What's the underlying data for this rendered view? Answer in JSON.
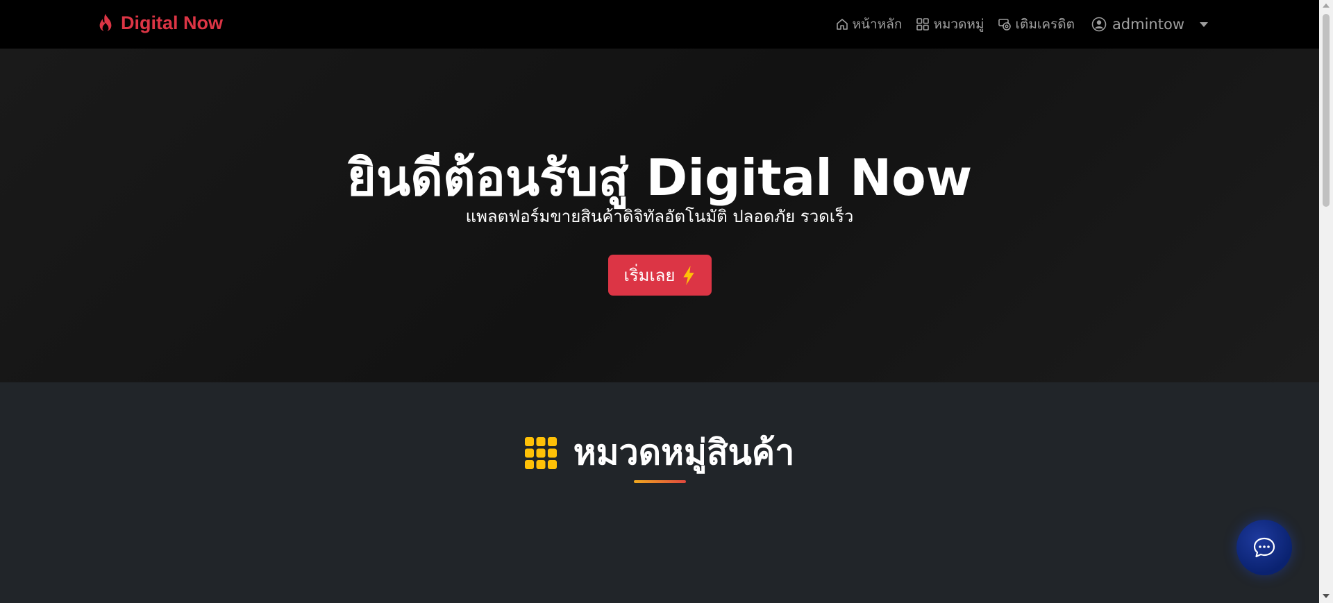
{
  "navbar": {
    "brand": "Digital Now",
    "brand_icon": "fire-icon",
    "items": [
      {
        "label": "หน้าหลัก",
        "icon": "house-icon"
      },
      {
        "label": "หมวดหมู่",
        "icon": "grid-icon"
      },
      {
        "label": "เติมเครดิต",
        "icon": "wallet-icon"
      }
    ],
    "user": {
      "name": "admintow",
      "icon": "user-circle-icon"
    }
  },
  "hero": {
    "title": "ยินดีต้อนรับสู่ Digital Now",
    "subtitle": "แพลตฟอร์มขายสินค้าดิจิทัลอัตโนมัติ ปลอดภัย รวดเร็ว",
    "button_label": "เริ่มเลย",
    "button_icon": "lightning-icon"
  },
  "section": {
    "title": "หมวดหมู่สินค้า",
    "icon": "grid-3x3-icon"
  },
  "chat": {
    "icon": "chat-icon"
  },
  "colors": {
    "brand": "#dc3545",
    "navbar_bg": "#000000",
    "section_bg": "#212529",
    "accent_yellow": "#ffc107",
    "chat_bg": "#0a2270"
  }
}
